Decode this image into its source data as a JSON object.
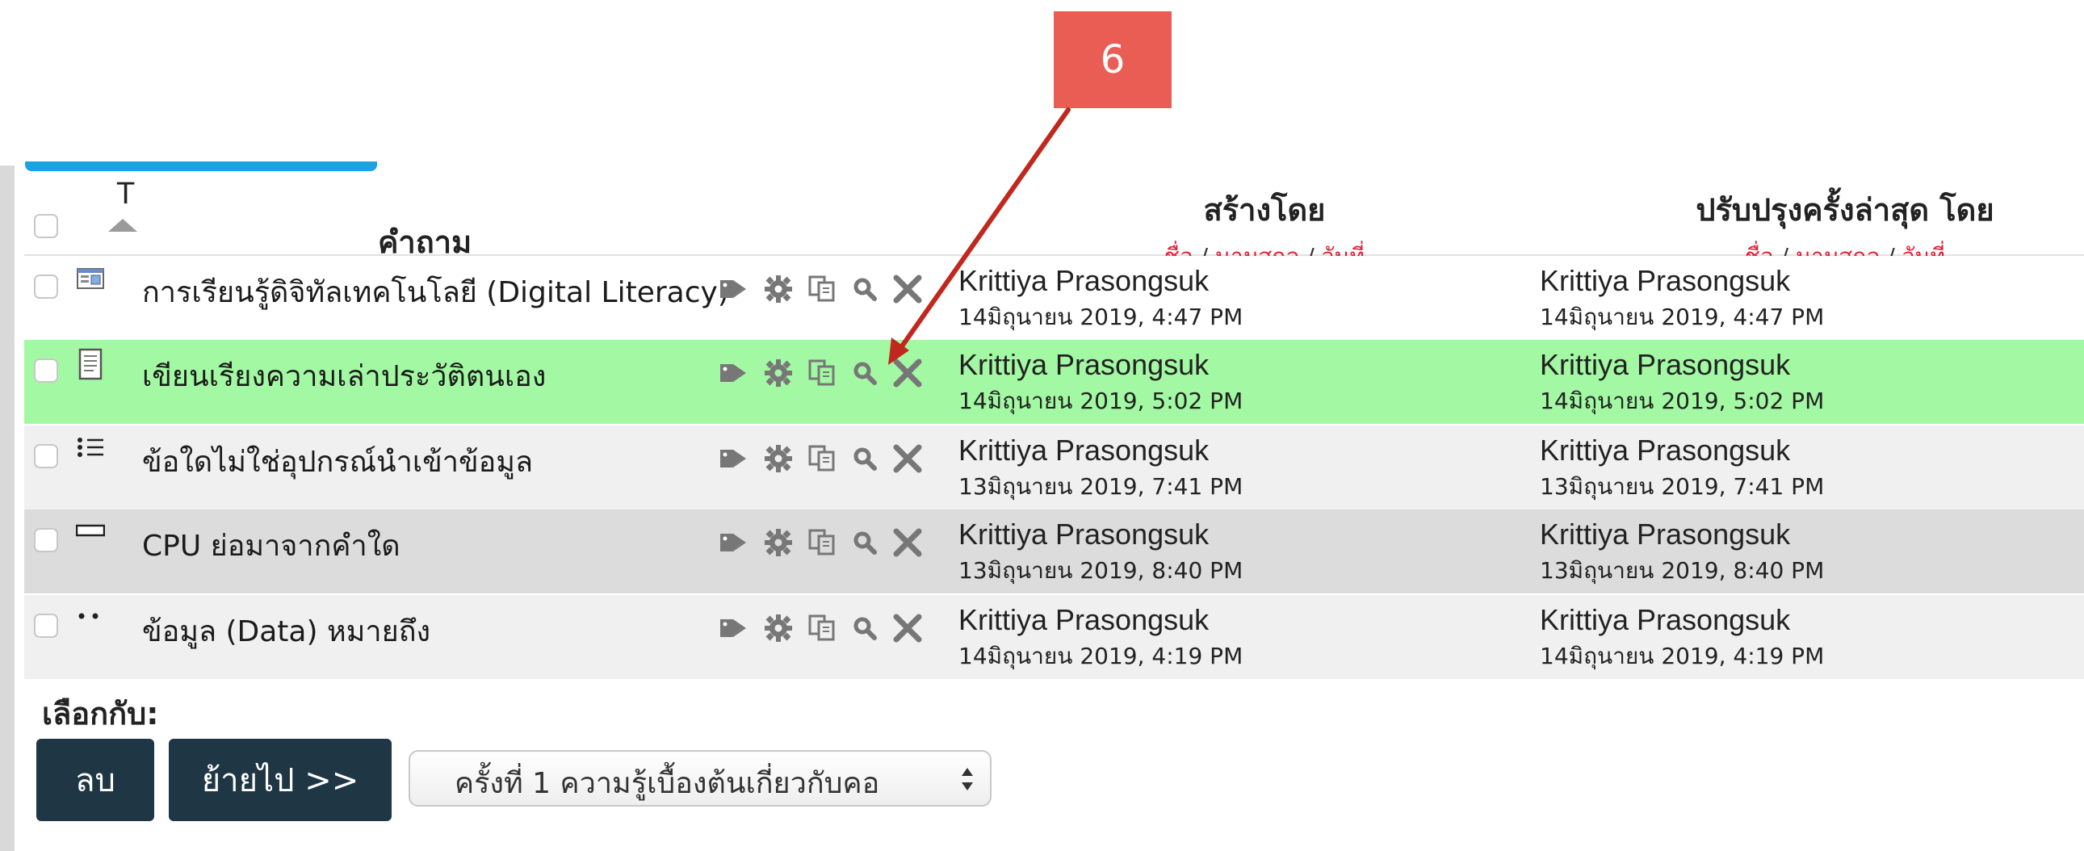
{
  "annotation": {
    "number": "6"
  },
  "header": {
    "type_label": "T",
    "question_label": "คำถาม",
    "created_by": "สร้างโดย",
    "modified_by": "ปรับปรุงครั้งล่าสุด โดย",
    "sort_first": "ชื่อ",
    "sort_last": "นามสกุล",
    "sort_date": "วันที่",
    "sep": " / "
  },
  "rows": [
    {
      "icon": "description-icon",
      "name": "การเรียนรู้ดิจิทัลเทคโนโลยี (Digital Literacy)",
      "created_name": "Krittiya Prasongsuk",
      "created_date": "14มิถุนายน 2019, 4:47 PM",
      "modified_name": "Krittiya Prasongsuk",
      "modified_date": "14มิถุนายน 2019, 4:47 PM"
    },
    {
      "icon": "essay-icon",
      "name": "เขียนเรียงความเล่าประวัติตนเอง",
      "created_name": "Krittiya Prasongsuk",
      "created_date": "14มิถุนายน 2019, 5:02 PM",
      "modified_name": "Krittiya Prasongsuk",
      "modified_date": "14มิถุนายน 2019, 5:02 PM"
    },
    {
      "icon": "multichoice-icon",
      "name": "ข้อใดไม่ใช่อุปกรณ์นำเข้าข้อมูล",
      "created_name": "Krittiya Prasongsuk",
      "created_date": "13มิถุนายน 2019, 7:41 PM",
      "modified_name": "Krittiya Prasongsuk",
      "modified_date": "13มิถุนายน 2019, 7:41 PM"
    },
    {
      "icon": "shortanswer-icon",
      "name": "CPU ย่อมาจากคำใด",
      "created_name": "Krittiya Prasongsuk",
      "created_date": "13มิถุนายน 2019, 8:40 PM",
      "modified_name": "Krittiya Prasongsuk",
      "modified_date": "13มิถุนายน 2019, 8:40 PM"
    },
    {
      "icon": "truefalse-icon",
      "name": "ข้อมูล (Data) หมายถึง",
      "created_name": "Krittiya Prasongsuk",
      "created_date": "14มิถุนายน 2019, 4:19 PM",
      "modified_name": "Krittiya Prasongsuk",
      "modified_date": "14มิถุนายน 2019, 4:19 PM"
    }
  ],
  "bulk": {
    "with_selected": "เลือกกับ:",
    "delete_label": "ลบ",
    "move_label": "ย้ายไป >>",
    "category_selected": "ครั้งที่ 1 ความรู้เบื้องต้นเกี่ยวกับคอ"
  },
  "colors": {
    "highlight_row": "#a3f9a3",
    "link_red": "#e0213c",
    "button_dark": "#1f3645",
    "callout": "#e95d55",
    "arrow": "#c0281e"
  }
}
